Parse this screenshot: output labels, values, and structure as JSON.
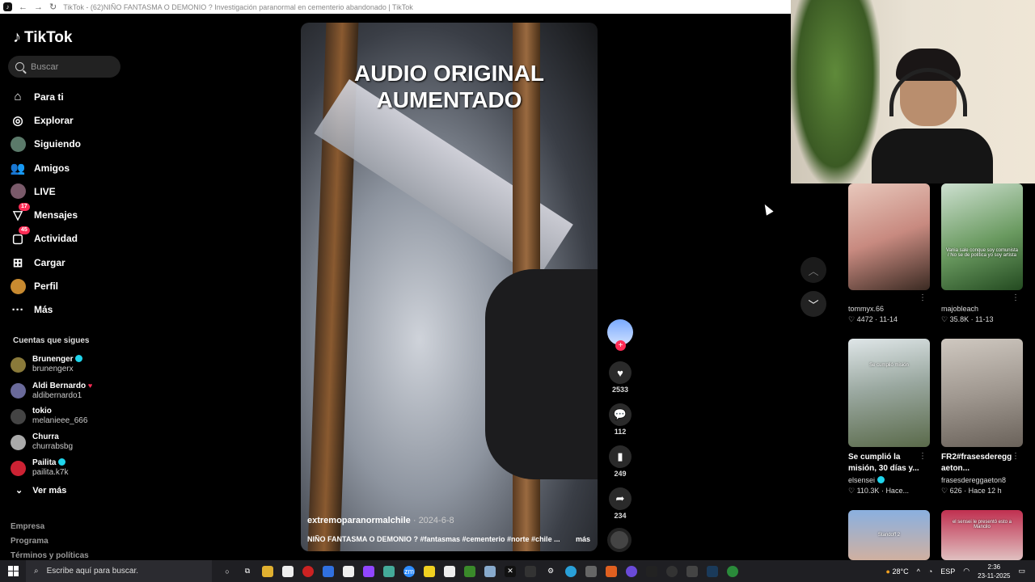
{
  "browser": {
    "tab_title": "TikTok - (62)NIÑO FANTASMA O DEMONIO ? Investigación paranormal en cementerio abandonado | TikTok"
  },
  "brand": {
    "name": "TikTok",
    "accent": "#fe2c55"
  },
  "search": {
    "placeholder": "Buscar"
  },
  "nav": [
    {
      "label": "Para ti",
      "icon": "home-icon"
    },
    {
      "label": "Explorar",
      "icon": "compass-icon"
    },
    {
      "label": "Siguiendo",
      "icon": "following-avatar-icon"
    },
    {
      "label": "Amigos",
      "icon": "friends-icon"
    },
    {
      "label": "LIVE",
      "icon": "live-icon"
    },
    {
      "label": "Mensajes",
      "icon": "messages-icon",
      "badge": "17"
    },
    {
      "label": "Actividad",
      "icon": "activity-icon",
      "badge": "45"
    },
    {
      "label": "Cargar",
      "icon": "upload-icon"
    },
    {
      "label": "Perfil",
      "icon": "profile-icon"
    },
    {
      "label": "Más",
      "icon": "more-icon"
    }
  ],
  "following": {
    "title": "Cuentas que sigues",
    "accounts": [
      {
        "name": "Brunenger",
        "user": "brunengerx"
      },
      {
        "name": "Aldi Bernardo",
        "user": "aldibernardo1"
      },
      {
        "name": "tokio",
        "user": "melanieee_666"
      },
      {
        "name": "Churra",
        "user": "churrabsbg"
      },
      {
        "name": "Pailita",
        "user": "pailita.k7k"
      }
    ],
    "see_more": "Ver más"
  },
  "footer": [
    "Empresa",
    "Programa",
    "Términos y políticas"
  ],
  "video": {
    "overlay_text_1": "AUDIO ORIGINAL",
    "overlay_text_2": "AUMENTADO",
    "author": "extremoparanormalchile",
    "date": "· 2024-6-8",
    "description": "NIÑO FANTASMA O DEMONIO ? #fantasmas #cementerio #norte #chile ...",
    "more": "más"
  },
  "actions": {
    "likes": "2533",
    "comments": "112",
    "saves": "249",
    "shares": "234"
  },
  "feed": [
    {
      "uname": "tommyx.66",
      "likes": "4472",
      "date": "11-14"
    },
    {
      "uname": "majobleach",
      "likes": "35.8K",
      "date": "11-13",
      "overlay": "Vania sale conque soy comunista / No se de política yo soy artista"
    },
    {
      "title": "Se cumplió la misión, 30 días y...",
      "uname": "elsensei",
      "likes": "110.3K",
      "date": "Hace...",
      "overlay": "Se cumplió misión"
    },
    {
      "title": "FR2#frasesderegg aeton...",
      "uname": "frasesdereggaeton8",
      "likes": "626",
      "date": "Hace 12 h"
    },
    {
      "overlay": "Standoff 2"
    },
    {
      "overlay": "el sensei le presentó esto a Mancilo"
    }
  ],
  "taskbar": {
    "search_placeholder": "Escribe aquí para buscar.",
    "weather": "28°C",
    "lang": "ESP",
    "time": "2:36",
    "date": "23-11-2025"
  }
}
